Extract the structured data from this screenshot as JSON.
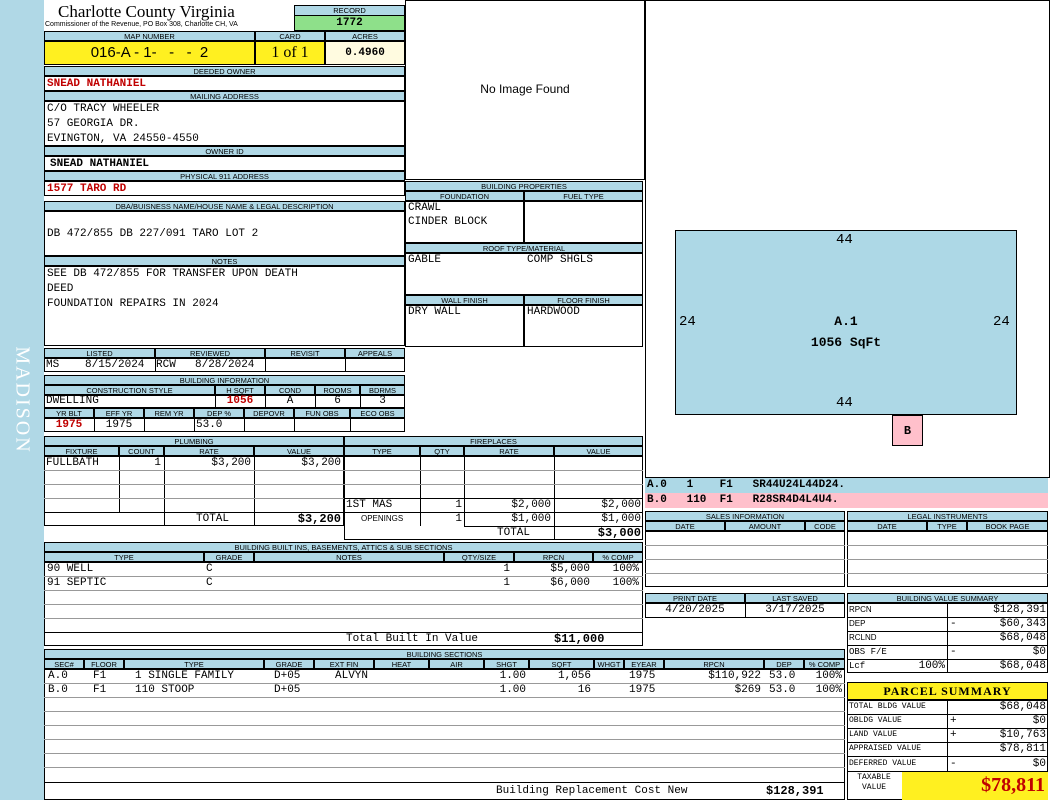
{
  "side_label": "MADISON",
  "header": {
    "county": "Charlotte County Virginia",
    "commissioner": "Commissioner of the Revenue, PO Box 308, Charlotte CH, VA",
    "record_label": "RECORD",
    "record": "1772",
    "map_number_label": "MAP NUMBER",
    "map_number": "016-A - 1-   -   -  2",
    "card_label": "CARD",
    "card": "1 of 1",
    "acres_label": "ACRES",
    "acres": "0.4960"
  },
  "owner": {
    "deeded_owner_label": "DEEDED OWNER",
    "deeded_owner": "SNEAD NATHANIEL",
    "mailing_label": "MAILING ADDRESS",
    "mailing_lines": [
      "C/O TRACY WHEELER",
      "57 GEORGIA DR.",
      "EVINGTON, VA 24550-4550"
    ],
    "owner_id_label": "OWNER ID",
    "owner_id": "SNEAD NATHANIEL",
    "physical_label": "PHYSICAL 911 ADDRESS",
    "physical": "1577 TARO RD"
  },
  "legal": {
    "label": "DBA/BUISNESS NAME/HOUSE NAME & LEGAL DESCRIPTION",
    "text": "DB 472/855 DB 227/091 TARO LOT 2"
  },
  "notes": {
    "label": "NOTES",
    "lines": [
      "SEE DB 472/855 FOR TRANSFER UPON DEATH",
      "DEED",
      "FOUNDATION REPAIRS IN 2024"
    ]
  },
  "listing": {
    "listed_label": "LISTED",
    "listed_by": "MS",
    "listed_date": "8/15/2024",
    "reviewed_label": "REVIEWED",
    "reviewed_by": "RCW",
    "reviewed_date": "8/28/2024",
    "revisit_label": "REVISIT",
    "appeals_label": "APPEALS"
  },
  "building_info": {
    "label": "BUILDING INFORMATION",
    "construction_style_label": "CONSTRUCTION STYLE",
    "hsqft_label": "H SQFT",
    "cond_label": "COND",
    "rooms_label": "ROOMS",
    "bdrms_label": "BDRMS",
    "construction_style": "DWELLING",
    "hsqft": "1056",
    "cond": "A",
    "rooms": "6",
    "bdrms": "3",
    "yr_blt_label": "YR BLT",
    "eff_yr_label": "EFF YR",
    "rem_yr_label": "REM YR",
    "dep_label": "DEP %",
    "depovr_label": "DEPOVR",
    "fun_obs_label": "FUN OBS",
    "eco_obs_label": "ECO OBS",
    "yr_blt": "1975",
    "eff_yr": "1975",
    "dep": "53.0"
  },
  "image": {
    "placeholder": "No Image Found"
  },
  "building_properties": {
    "label": "BUILDING PROPERTIES",
    "foundation_label": "FOUNDATION",
    "fuel_type_label": "FUEL TYPE",
    "foundation_lines": [
      "CRAWL",
      "CINDER BLOCK"
    ],
    "roof_label": "ROOF TYPE/MATERIAL",
    "roof_type": "GABLE",
    "roof_material": "COMP SHGLS",
    "wall_finish_label": "WALL FINISH",
    "floor_finish_label": "FLOOR FINISH",
    "wall_finish": "DRY WALL",
    "floor_finish": "HARDWOOD"
  },
  "sketch": {
    "top": "44",
    "bottom": "44",
    "left": "24",
    "right": "24",
    "area_label": "A.1",
    "area_sqft": "1056 SqFt",
    "small_label": "B",
    "line_a": "A.0   1    F1   SR44U24L44D24.",
    "line_b": "B.0   110  F1   R28SR4D4L4U4."
  },
  "plumbing": {
    "label": "PLUMBING",
    "fixture_label": "FIXTURE",
    "count_label": "COUNT",
    "rate_label": "RATE",
    "value_label": "VALUE",
    "rows": [
      {
        "fixture": "FULLBATH",
        "count": "1",
        "rate": "$3,200",
        "value": "$3,200"
      }
    ],
    "total_label": "TOTAL",
    "total": "$3,200"
  },
  "fireplaces": {
    "label": "FIREPLACES",
    "type_label": "TYPE",
    "qty_label": "QTY",
    "rate_label": "RATE",
    "value_label": "VALUE",
    "row1_type": "1ST MAS",
    "row1_qty": "1",
    "row1_rate": "$2,000",
    "row1_value": "$2,000",
    "row2_type": "OPENINGS",
    "row2_qty": "1",
    "row2_rate": "$1,000",
    "row2_value": "$1,000",
    "total_label": "TOTAL",
    "total": "$3,000"
  },
  "sales": {
    "label": "SALES INFORMATION",
    "date_label": "DATE",
    "amount_label": "AMOUNT",
    "code_label": "CODE"
  },
  "legal_instruments": {
    "label": "LEGAL INSTRUMENTS",
    "date_label": "DATE",
    "type_label": "TYPE",
    "bookpage_label": "BOOK PAGE"
  },
  "built_ins": {
    "label": "BUILDING BUILT INS, BASEMENTS, ATTICS & SUB SECTIONS",
    "type_label": "TYPE",
    "grade_label": "GRADE",
    "notes_label": "NOTES",
    "qty_label": "QTY/SIZE",
    "rpcn_label": "RPCN",
    "comp_label": "% COMP",
    "rows": [
      {
        "type": "90 WELL",
        "grade": "C",
        "qty": "1",
        "rpcn": "$5,000",
        "comp": "100%"
      },
      {
        "type": "91 SEPTIC",
        "grade": "C",
        "qty": "1",
        "rpcn": "$6,000",
        "comp": "100%"
      }
    ],
    "total_label": "Total Built In Value",
    "total": "$11,000"
  },
  "dates": {
    "print_label": "PRINT DATE",
    "print_date": "4/20/2025",
    "saved_label": "LAST SAVED",
    "saved_date": "3/17/2025"
  },
  "value_summary": {
    "label": "BUILDING VALUE SUMMARY",
    "rpcn_label": "RPCN",
    "rpcn": "$128,391",
    "dep_label": "DEP",
    "dep_sign": "-",
    "dep": "$60,343",
    "rclnd_label": "RCLND",
    "rclnd": "$68,048",
    "obs_label": "OBS F/E",
    "obs_sign": "-",
    "obs": "$0",
    "lcf_label": "Lcf",
    "lcf_pct": "100%",
    "lcf": "$68,048"
  },
  "parcel_summary": {
    "label": "PARCEL SUMMARY",
    "total_bldg_label": "TOTAL BLDG VALUE",
    "total_bldg": "$68,048",
    "obldg_label": "OBLDG VALUE",
    "obldg_sign": "+",
    "obldg": "$0",
    "land_label": "LAND VALUE",
    "land_sign": "+",
    "land": "$10,763",
    "appraised_label": "APPRAISED VALUE",
    "appraised": "$78,811",
    "deferred_label": "DEFERRED VALUE",
    "deferred_sign": "-",
    "deferred": "$0",
    "taxable_label_1": "TAXABLE",
    "taxable_label_2": "VALUE",
    "taxable": "$78,811"
  },
  "sections": {
    "label": "BUILDING SECTIONS",
    "headers": [
      "SEC#",
      "FLOOR",
      "TYPE",
      "GRADE",
      "EXT FIN",
      "HEAT",
      "AIR",
      "SHGT",
      "SQFT",
      "WHGT",
      "EYEAR",
      "RPCN",
      "DEP",
      "% COMP"
    ],
    "rows": [
      {
        "sec": "A.0",
        "floor": "F1",
        "type": "1 SINGLE FAMILY",
        "grade": "D+05",
        "ext": "ALVYN",
        "shgt": "1.00",
        "sqft": "1,056",
        "eyear": "1975",
        "rpcn": "$110,922",
        "dep": "53.0",
        "comp": "100%"
      },
      {
        "sec": "B.0",
        "floor": "F1",
        "type": "110 STOOP",
        "grade": "D+05",
        "ext": "",
        "shgt": "1.00",
        "sqft": "16",
        "eyear": "1975",
        "rpcn": "$269",
        "dep": "53.0",
        "comp": "100%"
      }
    ],
    "total_label": "Building Replacement Cost New",
    "total": "$128,391"
  }
}
